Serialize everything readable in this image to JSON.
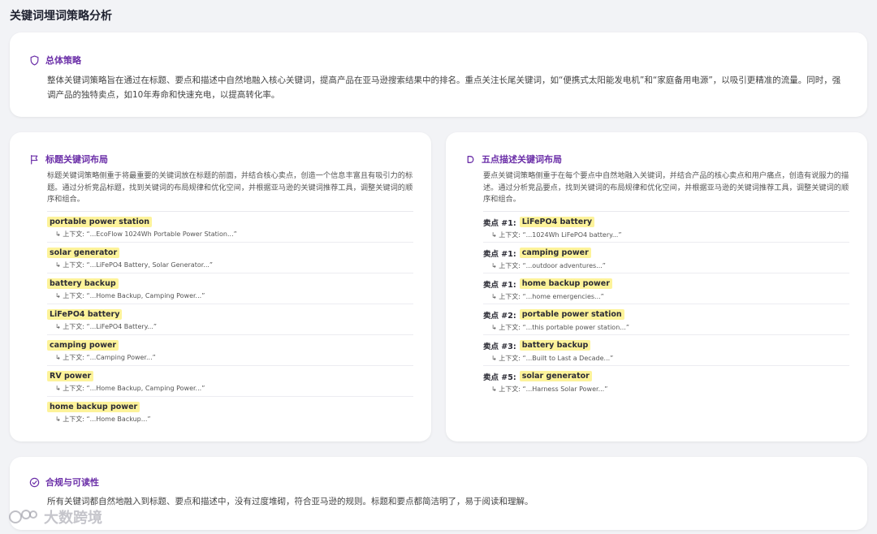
{
  "page": {
    "title": "关键词埋词策略分析"
  },
  "overall": {
    "heading": "总体策略",
    "text": "整体关键词策略旨在通过在标题、要点和描述中自然地融入核心关键词，提高产品在亚马逊搜索结果中的排名。重点关注长尾关键词，如“便携式太阳能发电机”和“家庭备用电源”，以吸引更精准的流量。同时，强调产品的独特卖点，如10年寿命和快速充电，以提高转化率。"
  },
  "title_section": {
    "heading": "标题关键词布局",
    "description": "标题关键词策略侧重于将最重要的关键词放在标题的前面，并结合核心卖点，创造一个信息丰富且有吸引力的标题。通过分析竞品标题，找到关键词的布局规律和优化空间，并根据亚马逊的关键词推荐工具，调整关键词的顺序和组合。",
    "items": [
      {
        "keyword": "portable power station",
        "context": "↳ 上下文: “...EcoFlow 1024Wh Portable Power Station...”"
      },
      {
        "keyword": "solar generator",
        "context": "↳ 上下文: “...LiFePO4 Battery, Solar Generator...”"
      },
      {
        "keyword": "battery backup",
        "context": "↳ 上下文: “...Home Backup, Camping Power...”"
      },
      {
        "keyword": "LiFePO4 battery",
        "context": "↳ 上下文: “...LiFePO4 Battery...”"
      },
      {
        "keyword": "camping power",
        "context": "↳ 上下文: “...Camping Power...”"
      },
      {
        "keyword": "RV power",
        "context": "↳ 上下文: “...Home Backup, Camping Power...”"
      },
      {
        "keyword": "home backup power",
        "context": "↳ 上下文: “...Home Backup...”"
      }
    ]
  },
  "bullet_section": {
    "heading": "五点描述关键词布局",
    "description": "要点关键词策略侧重于在每个要点中自然地融入关键词，并结合产品的核心卖点和用户痛点，创造有说服力的描述。通过分析竞品要点，找到关键词的布局规律和优化空间，并根据亚马逊的关键词推荐工具，调整关键词的顺序和组合。",
    "items": [
      {
        "prefix": "卖点 #1:",
        "keyword": "LiFePO4 battery",
        "context": "↳ 上下文: “...1024Wh LiFePO4 battery...”"
      },
      {
        "prefix": "卖点 #1:",
        "keyword": "camping power",
        "context": "↳ 上下文: “...outdoor adventures...”"
      },
      {
        "prefix": "卖点 #1:",
        "keyword": "home backup power",
        "context": "↳ 上下文: “...home emergencies...”"
      },
      {
        "prefix": "卖点 #2:",
        "keyword": "portable power station",
        "context": "↳ 上下文: “...this portable power station...”"
      },
      {
        "prefix": "卖点 #3:",
        "keyword": "battery backup",
        "context": "↳ 上下文: “...Built to Last a Decade...”"
      },
      {
        "prefix": "卖点 #5:",
        "keyword": "solar generator",
        "context": "↳ 上下文: “...Harness Solar Power...”"
      }
    ]
  },
  "compliance": {
    "heading": "合规与可读性",
    "text": "所有关键词都自然地融入到标题、要点和描述中，没有过度堆砌，符合亚马逊的规则。标题和要点都简洁明了，易于阅读和理解。"
  },
  "watermark": {
    "text": "大数跨境"
  },
  "colors": {
    "accent": "#6b2fa8",
    "highlight": "#fdf39a",
    "background": "#f2f3f6"
  },
  "icons": {
    "overall": "shield-icon",
    "title": "flag-icon",
    "bullet": "d-shape-icon",
    "compliance": "check-circle-icon"
  }
}
